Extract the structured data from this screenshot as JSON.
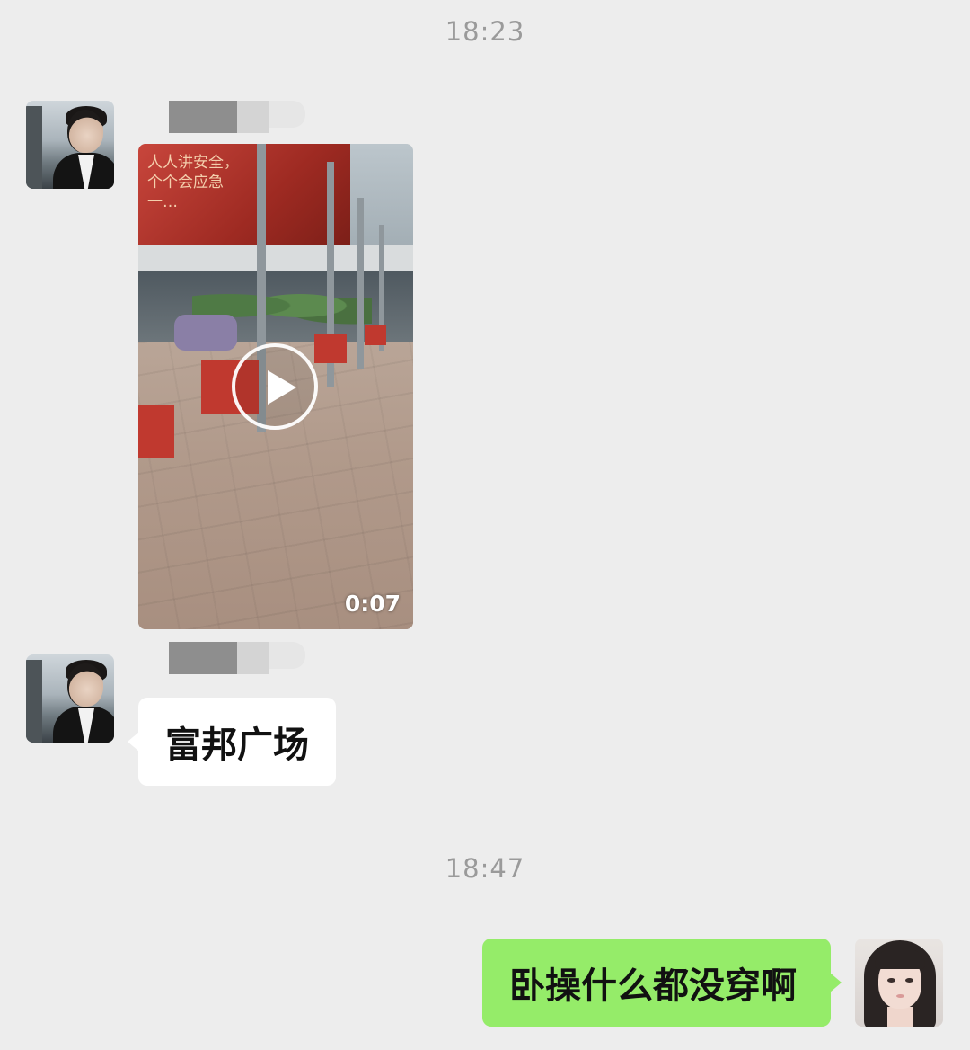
{
  "chat": {
    "timestamps": [
      "18:23",
      "18:47"
    ],
    "messages": [
      {
        "sender": "contact",
        "type": "video",
        "duration": "0:07",
        "thumbnail_text": [
          "人人讲安全，",
          "个个会应急",
          "一…"
        ]
      },
      {
        "sender": "contact",
        "type": "text",
        "text": "富邦广场"
      },
      {
        "sender": "me",
        "type": "text",
        "text": "卧操什么都没穿啊"
      }
    ]
  },
  "colors": {
    "background": "#ededed",
    "outgoing_bubble": "#95ec69",
    "incoming_bubble": "#ffffff",
    "timestamp_text": "#9a9a9a"
  },
  "icons": {
    "contact_avatar": "avatar",
    "my_avatar": "avatar",
    "video_play": "play-icon"
  }
}
